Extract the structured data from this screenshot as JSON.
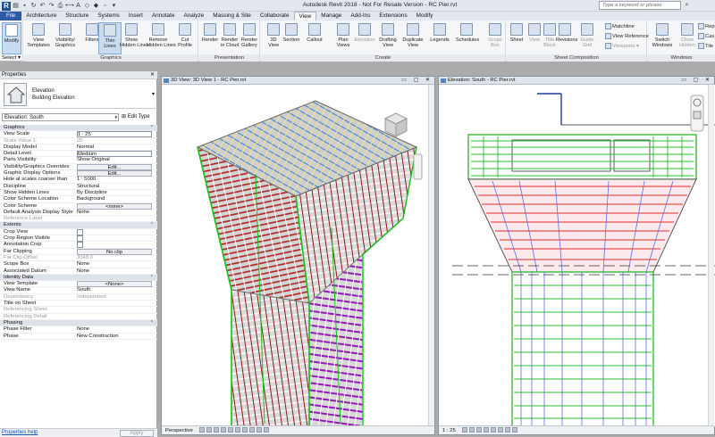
{
  "titlebar": {
    "title": "Autodesk Revit 2018 -  Not For Resale Version -    RC Pier.rvt",
    "search_placeholder": "Type a keyword or phrase",
    "app_logo": "R"
  },
  "tabs": [
    "File",
    "Architecture",
    "Structure",
    "Systems",
    "Insert",
    "Annotate",
    "Analyze",
    "Massing & Site",
    "Collaborate",
    "View",
    "Manage",
    "Add-Ins",
    "Extensions",
    "Modify"
  ],
  "ribbon": {
    "modify": {
      "label": "Modify",
      "panel": "Select"
    },
    "graphics": {
      "title": "Graphics",
      "buttons": [
        [
          "View",
          "Templates"
        ],
        [
          "Visibility/",
          "Graphics"
        ],
        [
          "Filters",
          ""
        ],
        [
          "Thin",
          "Lines"
        ],
        [
          "Show",
          "Hidden Lines"
        ],
        [
          "Remove",
          "Hidden Lines"
        ],
        [
          "Cut",
          "Profile"
        ]
      ]
    },
    "presentation": {
      "title": "Presentation",
      "buttons": [
        [
          "Render",
          ""
        ],
        [
          "Render",
          "in Cloud"
        ],
        [
          "Render",
          "Gallery"
        ]
      ]
    },
    "create": {
      "title": "Create",
      "buttons": [
        [
          "3D",
          "View"
        ],
        [
          "Section",
          ""
        ],
        [
          "Callout",
          ""
        ],
        [
          "Plan",
          "Views"
        ],
        [
          "Elevation",
          ""
        ],
        [
          "Drafting",
          "View"
        ],
        [
          "Duplicate",
          "View"
        ],
        [
          "Legends",
          ""
        ],
        [
          "Schedules",
          ""
        ],
        [
          "Scope",
          "Box"
        ]
      ]
    },
    "sheet": {
      "title": "Sheet Composition",
      "buttons": [
        [
          "Sheet",
          ""
        ],
        [
          "View",
          ""
        ],
        [
          "Title",
          "Block"
        ],
        [
          "Revisions",
          ""
        ],
        [
          "Guide",
          "Grid"
        ]
      ],
      "small": [
        "Matchline",
        "View  Reference",
        "Viewports"
      ]
    },
    "windows": {
      "title": "Windows",
      "buttons": [
        [
          "Switch",
          "Windows"
        ],
        [
          "Close",
          "Hidden"
        ]
      ],
      "small": [
        "Rep",
        "Cas",
        "Tile"
      ]
    }
  },
  "properties": {
    "header": "Properties",
    "type_family": "Elevation",
    "type_name": "Building Elevation",
    "instance": "Elevation: South",
    "edit_type": "Edit Type",
    "help": "Properties help",
    "apply": "Apply",
    "rows": [
      {
        "cat": "Graphics"
      },
      {
        "k": "View Scale",
        "v": "1 : 25",
        "s": "box"
      },
      {
        "k": "Scale Value   1:",
        "v": "25",
        "dim": true
      },
      {
        "k": "Display Model",
        "v": "Normal"
      },
      {
        "k": "Detail Level",
        "v": "Medium",
        "s": "box"
      },
      {
        "k": "Parts Visibility",
        "v": "Show Original"
      },
      {
        "k": "Visibility/Graphics Overrides",
        "v": "Edit...",
        "s": "btn"
      },
      {
        "k": "Graphic Display Options",
        "v": "Edit...",
        "s": "btn"
      },
      {
        "k": "Hide at scales coarser than",
        "v": "1 : 5000"
      },
      {
        "k": "Discipline",
        "v": "Structural"
      },
      {
        "k": "Show Hidden Lines",
        "v": "By Discipline"
      },
      {
        "k": "Color Scheme Location",
        "v": "Background"
      },
      {
        "k": "Color Scheme",
        "v": "<none>",
        "s": "btn"
      },
      {
        "k": "Default Analysis Display Style",
        "v": "None"
      },
      {
        "k": "Reference Label",
        "v": "",
        "dim": true
      },
      {
        "cat": "Extents"
      },
      {
        "k": "Crop View",
        "v": "",
        "s": "chk"
      },
      {
        "k": "Crop Region Visible",
        "v": "",
        "s": "chk"
      },
      {
        "k": "Annotation Crop",
        "v": "",
        "s": "chk"
      },
      {
        "k": "Far Clipping",
        "v": "No clip",
        "s": "btn"
      },
      {
        "k": "Far Clip Offset",
        "v": "3048.0",
        "dim": true
      },
      {
        "k": "Scope Box",
        "v": "None"
      },
      {
        "k": "Associated Datum",
        "v": "None"
      },
      {
        "cat": "Identity Data"
      },
      {
        "k": "View Template",
        "v": "<None>",
        "s": "btn"
      },
      {
        "k": "View Name",
        "v": "South"
      },
      {
        "k": "Dependency",
        "v": "Independent",
        "dim": true
      },
      {
        "k": "Title on Sheet",
        "v": ""
      },
      {
        "k": "Referencing Sheet",
        "v": "",
        "dim": true
      },
      {
        "k": "Referencing Detail",
        "v": "",
        "dim": true
      },
      {
        "cat": "Phasing"
      },
      {
        "k": "Phase Filter",
        "v": "None"
      },
      {
        "k": "Phase",
        "v": "New Construction"
      }
    ]
  },
  "view3d": {
    "title": "3D View: 3D View 1 - RC Pier.rvt",
    "mode": "Perspective"
  },
  "elevation": {
    "title": "Elevation: South - RC Pier.rvt",
    "scale": "1 : 25"
  },
  "colors": {
    "concrete": "#c8c8c8",
    "rebar_red": "#c02020",
    "rebar_green": "#18c018",
    "rebar_purple": "#a020c0",
    "rebar_blue": "#3050d0",
    "rebar_cyan": "#30c0c0"
  }
}
